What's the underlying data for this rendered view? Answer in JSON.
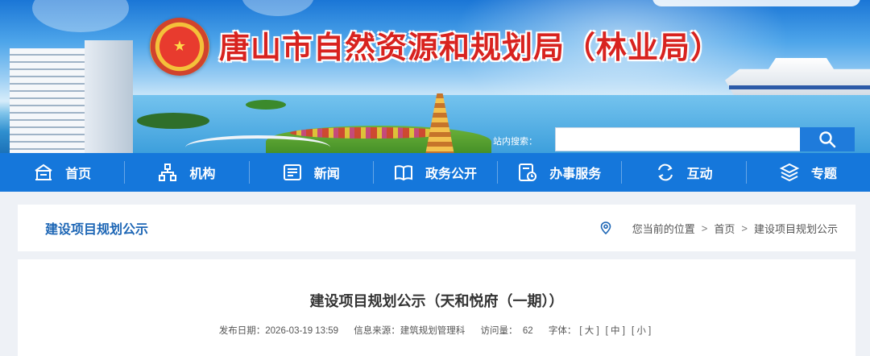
{
  "header": {
    "site_title": "唐山市自然资源和规划局（林业局）",
    "search_label": "站内搜索：",
    "search_value": "",
    "search_icon": "search-icon"
  },
  "nav": {
    "items": [
      {
        "label": "首页",
        "icon": "home-icon"
      },
      {
        "label": "机构",
        "icon": "org-icon"
      },
      {
        "label": "新闻",
        "icon": "news-icon"
      },
      {
        "label": "政务公开",
        "icon": "book-icon"
      },
      {
        "label": "办事服务",
        "icon": "service-icon"
      },
      {
        "label": "互动",
        "icon": "interact-icon"
      },
      {
        "label": "专题",
        "icon": "layers-icon"
      }
    ]
  },
  "breadcrumb": {
    "section_title": "建设项目规划公示",
    "location_label": "您当前的位置",
    "sep": ">",
    "home": "首页",
    "current": "建设项目规划公示"
  },
  "article": {
    "title": "建设项目规划公示（天和悦府（一期））",
    "date_label": "发布日期：",
    "date": "2026-03-19 13:59",
    "source_label": "信息来源：",
    "source": "建筑规划管理科",
    "views_label": "访问量：",
    "views": "62",
    "font_label": "字体：",
    "font_large": "[ 大 ]",
    "font_medium": "[ 中 ]",
    "font_small": "[ 小 ]"
  },
  "colors": {
    "nav_bg": "#1577db",
    "title_red": "#d8231f",
    "section_blue": "#1d66b5"
  }
}
